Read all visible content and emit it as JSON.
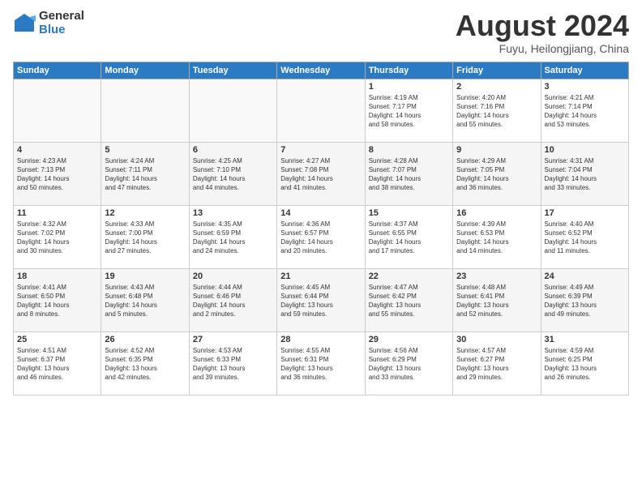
{
  "logo": {
    "general": "General",
    "blue": "Blue"
  },
  "title": "August 2024",
  "location": "Fuyu, Heilongjiang, China",
  "headers": [
    "Sunday",
    "Monday",
    "Tuesday",
    "Wednesday",
    "Thursday",
    "Friday",
    "Saturday"
  ],
  "weeks": [
    [
      {
        "day": "",
        "info": ""
      },
      {
        "day": "",
        "info": ""
      },
      {
        "day": "",
        "info": ""
      },
      {
        "day": "",
        "info": ""
      },
      {
        "day": "1",
        "info": "Sunrise: 4:19 AM\nSunset: 7:17 PM\nDaylight: 14 hours\nand 58 minutes."
      },
      {
        "day": "2",
        "info": "Sunrise: 4:20 AM\nSunset: 7:16 PM\nDaylight: 14 hours\nand 55 minutes."
      },
      {
        "day": "3",
        "info": "Sunrise: 4:21 AM\nSunset: 7:14 PM\nDaylight: 14 hours\nand 53 minutes."
      }
    ],
    [
      {
        "day": "4",
        "info": "Sunrise: 4:23 AM\nSunset: 7:13 PM\nDaylight: 14 hours\nand 50 minutes."
      },
      {
        "day": "5",
        "info": "Sunrise: 4:24 AM\nSunset: 7:11 PM\nDaylight: 14 hours\nand 47 minutes."
      },
      {
        "day": "6",
        "info": "Sunrise: 4:25 AM\nSunset: 7:10 PM\nDaylight: 14 hours\nand 44 minutes."
      },
      {
        "day": "7",
        "info": "Sunrise: 4:27 AM\nSunset: 7:08 PM\nDaylight: 14 hours\nand 41 minutes."
      },
      {
        "day": "8",
        "info": "Sunrise: 4:28 AM\nSunset: 7:07 PM\nDaylight: 14 hours\nand 38 minutes."
      },
      {
        "day": "9",
        "info": "Sunrise: 4:29 AM\nSunset: 7:05 PM\nDaylight: 14 hours\nand 36 minutes."
      },
      {
        "day": "10",
        "info": "Sunrise: 4:31 AM\nSunset: 7:04 PM\nDaylight: 14 hours\nand 33 minutes."
      }
    ],
    [
      {
        "day": "11",
        "info": "Sunrise: 4:32 AM\nSunset: 7:02 PM\nDaylight: 14 hours\nand 30 minutes."
      },
      {
        "day": "12",
        "info": "Sunrise: 4:33 AM\nSunset: 7:00 PM\nDaylight: 14 hours\nand 27 minutes."
      },
      {
        "day": "13",
        "info": "Sunrise: 4:35 AM\nSunset: 6:59 PM\nDaylight: 14 hours\nand 24 minutes."
      },
      {
        "day": "14",
        "info": "Sunrise: 4:36 AM\nSunset: 6:57 PM\nDaylight: 14 hours\nand 20 minutes."
      },
      {
        "day": "15",
        "info": "Sunrise: 4:37 AM\nSunset: 6:55 PM\nDaylight: 14 hours\nand 17 minutes."
      },
      {
        "day": "16",
        "info": "Sunrise: 4:39 AM\nSunset: 6:53 PM\nDaylight: 14 hours\nand 14 minutes."
      },
      {
        "day": "17",
        "info": "Sunrise: 4:40 AM\nSunset: 6:52 PM\nDaylight: 14 hours\nand 11 minutes."
      }
    ],
    [
      {
        "day": "18",
        "info": "Sunrise: 4:41 AM\nSunset: 6:50 PM\nDaylight: 14 hours\nand 8 minutes."
      },
      {
        "day": "19",
        "info": "Sunrise: 4:43 AM\nSunset: 6:48 PM\nDaylight: 14 hours\nand 5 minutes."
      },
      {
        "day": "20",
        "info": "Sunrise: 4:44 AM\nSunset: 6:46 PM\nDaylight: 14 hours\nand 2 minutes."
      },
      {
        "day": "21",
        "info": "Sunrise: 4:45 AM\nSunset: 6:44 PM\nDaylight: 13 hours\nand 59 minutes."
      },
      {
        "day": "22",
        "info": "Sunrise: 4:47 AM\nSunset: 6:42 PM\nDaylight: 13 hours\nand 55 minutes."
      },
      {
        "day": "23",
        "info": "Sunrise: 4:48 AM\nSunset: 6:41 PM\nDaylight: 13 hours\nand 52 minutes."
      },
      {
        "day": "24",
        "info": "Sunrise: 4:49 AM\nSunset: 6:39 PM\nDaylight: 13 hours\nand 49 minutes."
      }
    ],
    [
      {
        "day": "25",
        "info": "Sunrise: 4:51 AM\nSunset: 6:37 PM\nDaylight: 13 hours\nand 46 minutes."
      },
      {
        "day": "26",
        "info": "Sunrise: 4:52 AM\nSunset: 6:35 PM\nDaylight: 13 hours\nand 42 minutes."
      },
      {
        "day": "27",
        "info": "Sunrise: 4:53 AM\nSunset: 6:33 PM\nDaylight: 13 hours\nand 39 minutes."
      },
      {
        "day": "28",
        "info": "Sunrise: 4:55 AM\nSunset: 6:31 PM\nDaylight: 13 hours\nand 36 minutes."
      },
      {
        "day": "29",
        "info": "Sunrise: 4:56 AM\nSunset: 6:29 PM\nDaylight: 13 hours\nand 33 minutes."
      },
      {
        "day": "30",
        "info": "Sunrise: 4:57 AM\nSunset: 6:27 PM\nDaylight: 13 hours\nand 29 minutes."
      },
      {
        "day": "31",
        "info": "Sunrise: 4:59 AM\nSunset: 6:25 PM\nDaylight: 13 hours\nand 26 minutes."
      }
    ]
  ]
}
